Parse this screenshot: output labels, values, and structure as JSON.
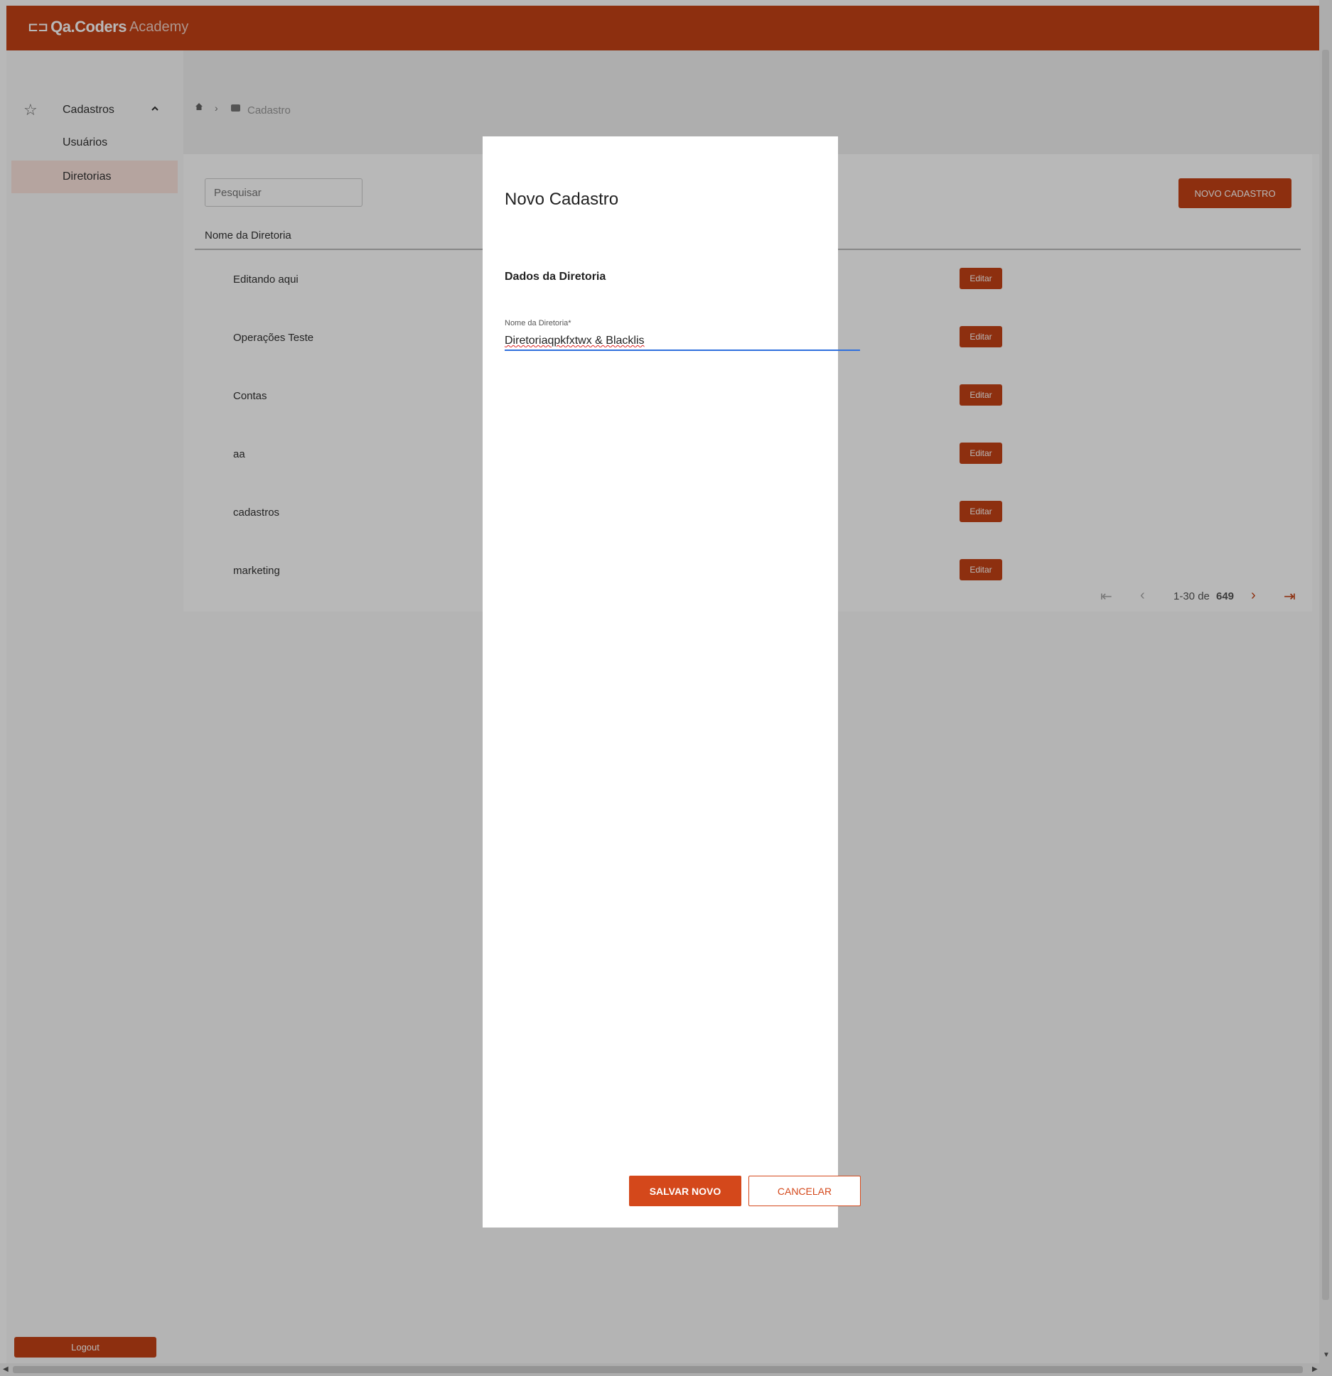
{
  "header": {
    "logo_mark": "⊏⊐",
    "logo_main": "Qa.Coders",
    "logo_sub": "Academy"
  },
  "sidebar": {
    "group_label": "Cadastros",
    "items": [
      {
        "label": "Usuários"
      },
      {
        "label": "Diretorias"
      }
    ],
    "logout_label": "Logout"
  },
  "breadcrumb": {
    "label": "Cadastro"
  },
  "toolbar": {
    "search_placeholder": "Pesquisar",
    "new_button": "NOVO CADASTRO"
  },
  "table": {
    "column_header": "Nome da Diretoria",
    "rows": [
      {
        "name": "Editando aqui",
        "action": "Editar"
      },
      {
        "name": "Operações Teste",
        "action": "Editar"
      },
      {
        "name": "Contas",
        "action": "Editar"
      },
      {
        "name": "aa",
        "action": "Editar"
      },
      {
        "name": "cadastros",
        "action": "Editar"
      },
      {
        "name": "marketing",
        "action": "Editar"
      }
    ]
  },
  "pagination": {
    "range": "1-30 de",
    "total": "649"
  },
  "modal": {
    "title": "Novo Cadastro",
    "section": "Dados da Diretoria",
    "field_label": "Nome da Diretoria*",
    "field_value": "Diretoriaqpkfxtwx & Blacklis",
    "save": "SALVAR NOVO",
    "cancel": "CANCELAR"
  },
  "colors": {
    "brand": "#c44216",
    "focus": "#2f6fdd"
  },
  "icons": [
    "home-icon",
    "chevron-right-icon",
    "folder-icon",
    "star-icon",
    "chevron-up-icon",
    "first-page-icon",
    "prev-page-icon",
    "next-page-icon",
    "last-page-icon"
  ]
}
